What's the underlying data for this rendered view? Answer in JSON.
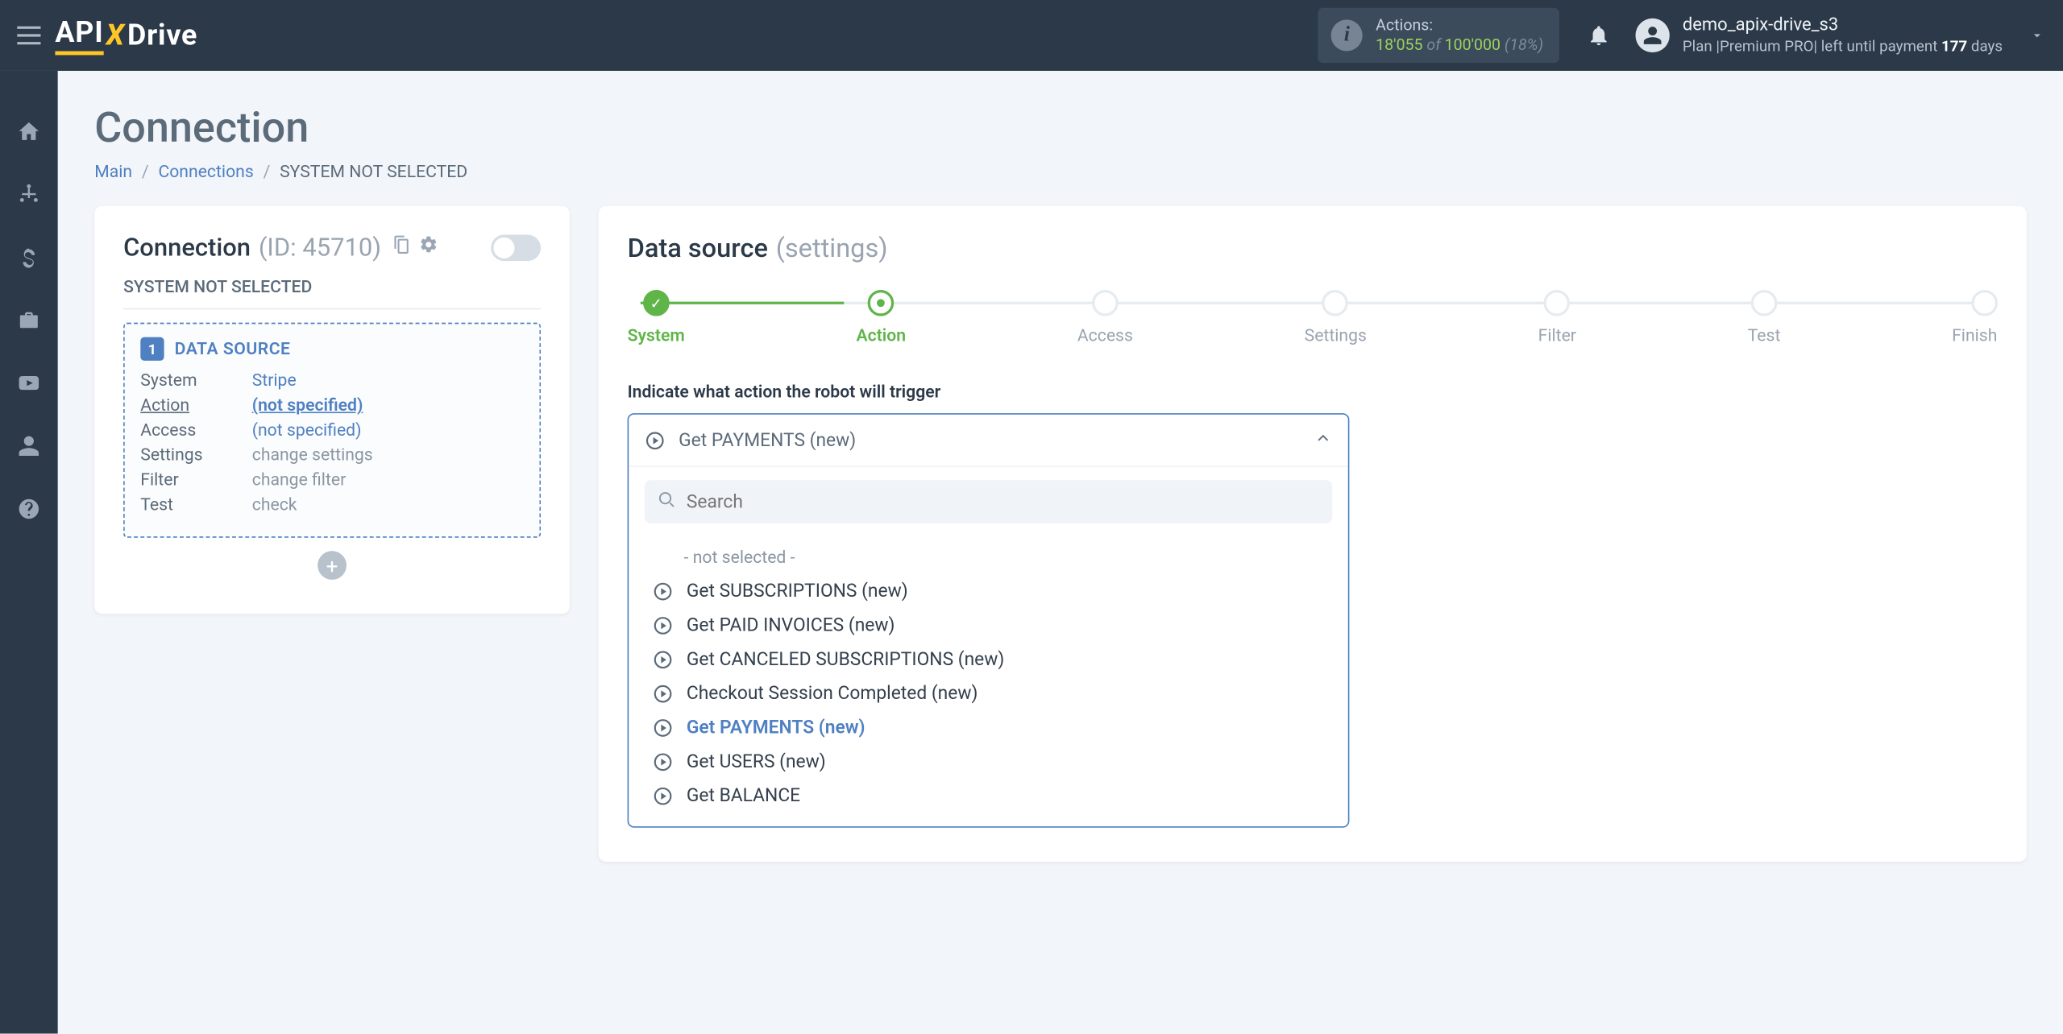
{
  "topbar": {
    "logo": {
      "api": "API",
      "x": "X",
      "drive": "Drive"
    },
    "actions": {
      "label": "Actions:",
      "used": "18'055",
      "of": "of",
      "total": "100'000",
      "pct": "(18%)"
    },
    "user": {
      "name": "demo_apix-drive_s3",
      "plan_prefix": "Plan |",
      "plan_name": "Premium PRO",
      "plan_mid": "| left until payment ",
      "days": "177",
      "days_suffix": " days"
    }
  },
  "sidebar": {
    "icons": [
      "home",
      "sitemap",
      "dollar",
      "briefcase",
      "youtube",
      "user",
      "help"
    ]
  },
  "page": {
    "title": "Connection",
    "breadcrumb": {
      "main": "Main",
      "connections": "Connections",
      "current": "SYSTEM NOT SELECTED"
    }
  },
  "left": {
    "title": "Connection",
    "id": "(ID: 45710)",
    "subtitle": "SYSTEM NOT SELECTED",
    "ds": {
      "badge": "1",
      "title": "DATA SOURCE",
      "rows": {
        "system": {
          "k": "System",
          "v": "Stripe"
        },
        "action": {
          "k": "Action",
          "v": "(not specified)"
        },
        "access": {
          "k": "Access",
          "v": "(not specified)"
        },
        "settings": {
          "k": "Settings",
          "v": "change settings"
        },
        "filter": {
          "k": "Filter",
          "v": "change filter"
        },
        "test": {
          "k": "Test",
          "v": "check"
        }
      }
    }
  },
  "right": {
    "title": "Data source",
    "subtitle": "(settings)",
    "steps": [
      "System",
      "Action",
      "Access",
      "Settings",
      "Filter",
      "Test",
      "Finish"
    ],
    "field_label": "Indicate what action the robot will trigger",
    "selected": "Get PAYMENTS (new)",
    "search_placeholder": "Search",
    "options": {
      "none": "- not selected -",
      "o1": "Get SUBSCRIPTIONS (new)",
      "o2": "Get PAID INVOICES (new)",
      "o3": "Get CANCELED SUBSCRIPTIONS (new)",
      "o4": "Checkout Session Completed (new)",
      "o5": "Get PAYMENTS (new)",
      "o6": "Get USERS (new)",
      "o7": "Get BALANCE"
    }
  }
}
